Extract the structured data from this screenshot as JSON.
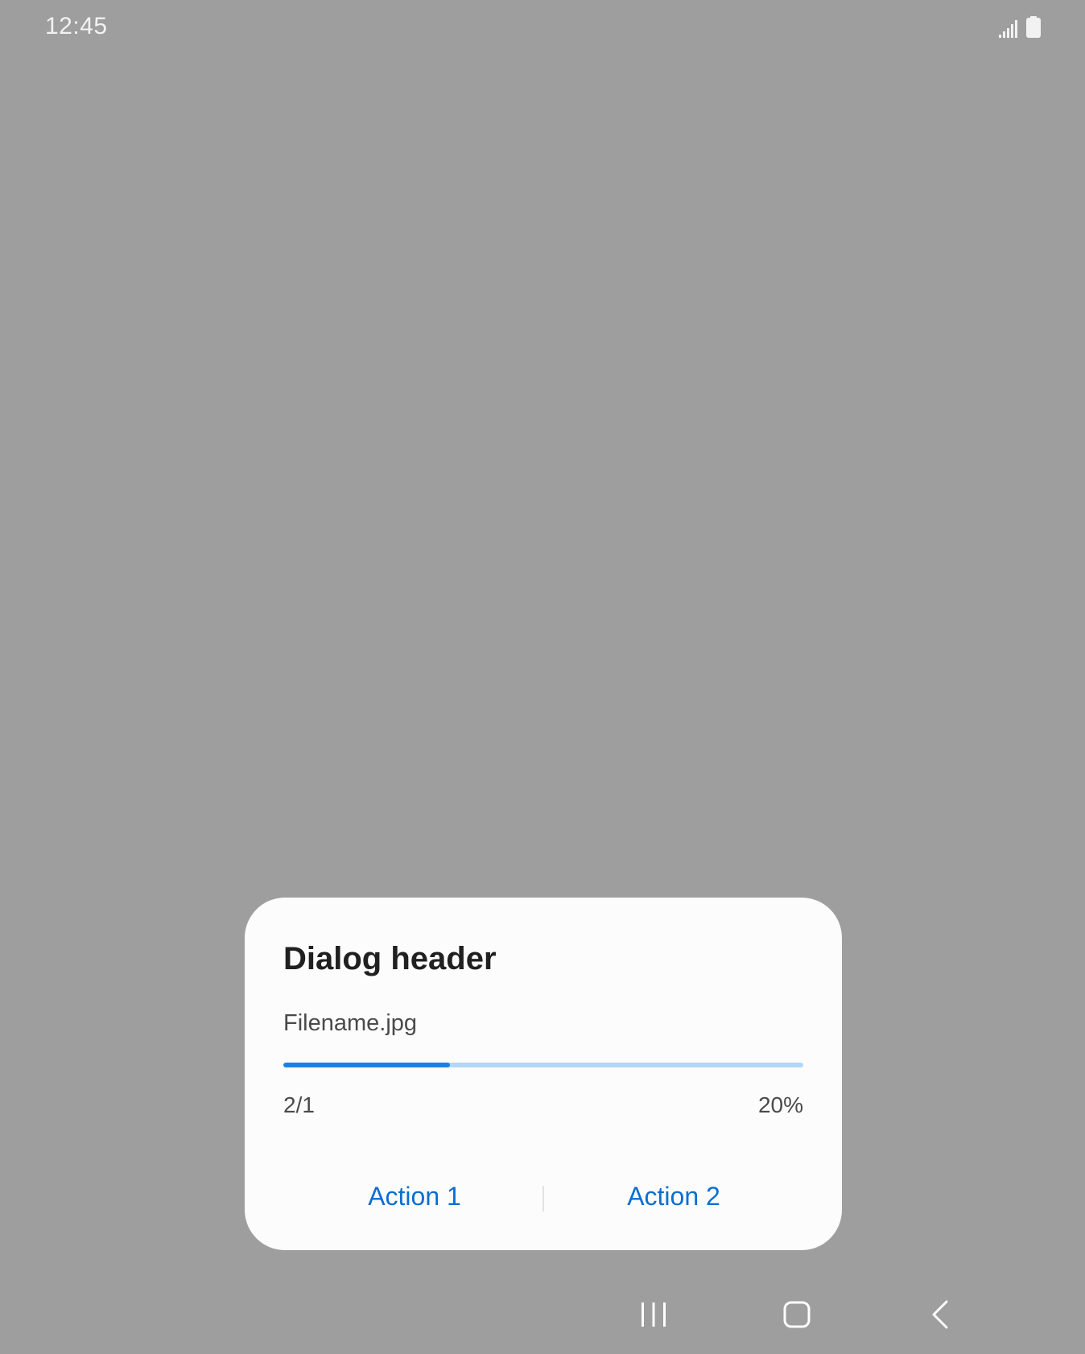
{
  "status_bar": {
    "time": "12:45",
    "icons": [
      "signal-icon",
      "battery-icon"
    ]
  },
  "dialog": {
    "title": "Dialog header",
    "file_name": "Filename.jpg",
    "progress": {
      "count_label": "2/1",
      "percent_label": "20%",
      "fill_fraction": 0.32
    },
    "actions": [
      {
        "label": "Action 1"
      },
      {
        "label": "Action 2"
      }
    ]
  },
  "nav_bar": {
    "icons": [
      "recents-icon",
      "home-icon",
      "back-icon"
    ]
  },
  "colors": {
    "scrim": "#9e9e9e",
    "dialog_bg": "#fcfcfc",
    "accent": "#0a6ed1",
    "progress_fill": "#1a81e6",
    "progress_track": "#b3d7f5"
  }
}
